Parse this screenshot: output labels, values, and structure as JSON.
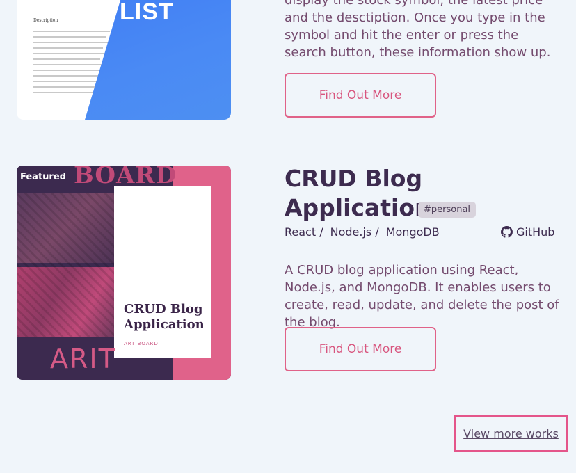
{
  "project_top": {
    "description": "display the stock symbol, the latest price and the desctiption. Once you type in the symbol and hit the enter or press the search button, these information show up.",
    "button_label": "Find Out More",
    "thumbnail": {
      "word": "LIST",
      "doc_heading": "Description"
    }
  },
  "project_featured": {
    "badge": "Featured",
    "title": "CRUD Blog Application",
    "tag": "#personal",
    "tech": [
      "React /",
      "Node.js /",
      "MongoDB"
    ],
    "github_label": "GitHub",
    "github_icon": "github-icon",
    "description": "A CRUD blog application using React, Node.js, and MongoDB. It enables users to create, read, update, and delete the post of the blog.",
    "button_label": "Find Out More",
    "thumbnail": {
      "board_word": "BOARD",
      "poster_title": "CRUD Blog Application",
      "poster_subtitle": "ART BOARD",
      "art_word": "ARIT"
    }
  },
  "view_more_label": "View more works",
  "colors": {
    "background": "#f0f5fa",
    "accent": "#e06288",
    "text_dark": "#3d2b4f",
    "text_body": "#744b6e"
  }
}
